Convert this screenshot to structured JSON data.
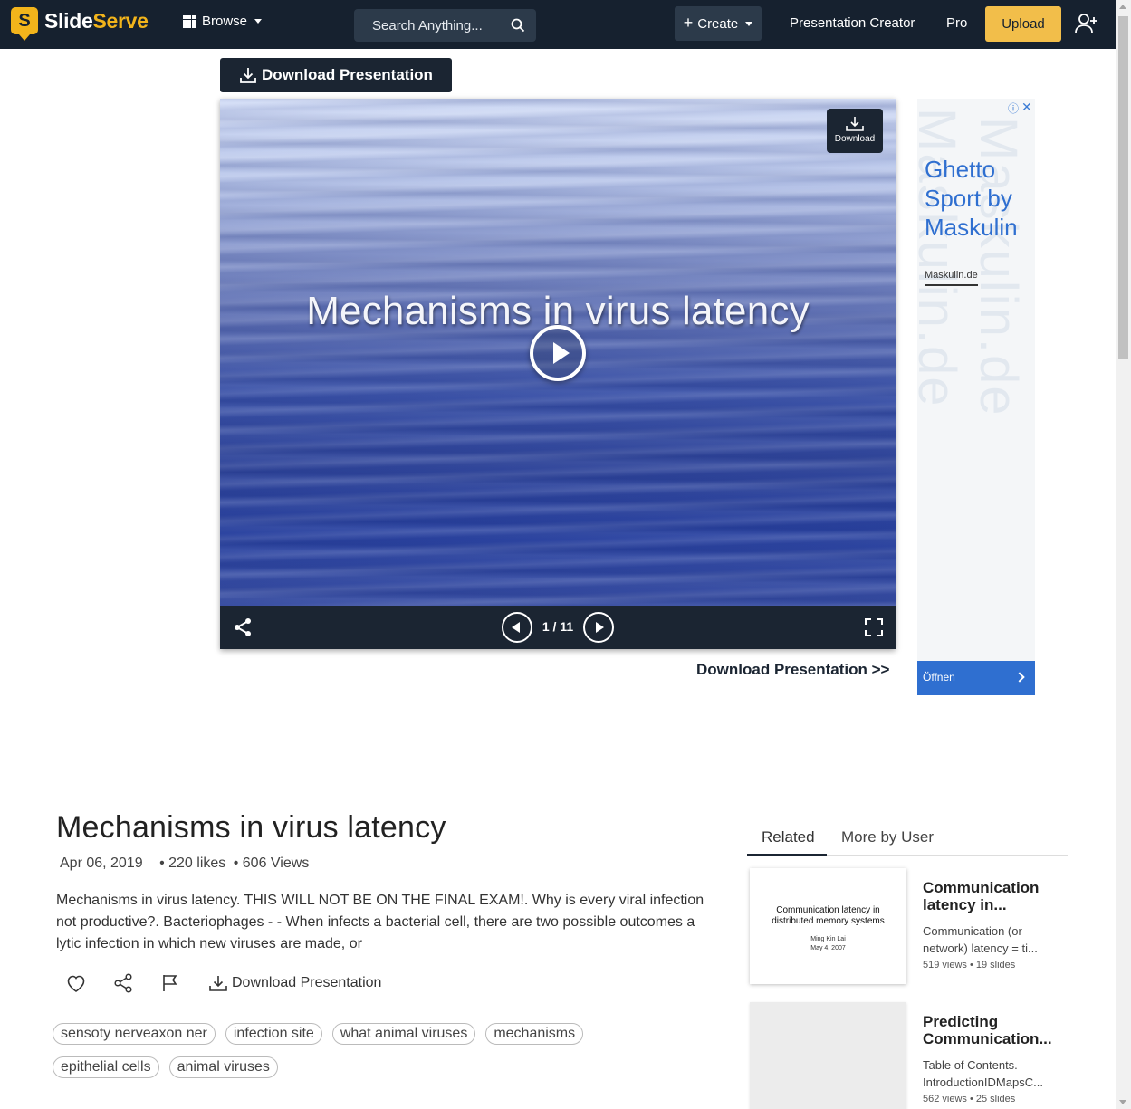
{
  "nav": {
    "brand_part1": "Slide",
    "brand_part2": "Serve",
    "brand_badge": "S",
    "browse": "Browse",
    "search_placeholder": "Search Anything...",
    "create": "Create",
    "presentation_creator": "Presentation Creator",
    "pro": "Pro",
    "upload": "Upload"
  },
  "download_top": "Download Presentation",
  "viewer": {
    "slide_title": "Mechanisms in virus latency",
    "download_label": "Download",
    "page_counter": "1 / 11"
  },
  "download_link": "Download Presentation >>",
  "ad": {
    "headline": "Ghetto Sport by Maskulin",
    "domain": "Maskulin.de",
    "open": "Öffnen",
    "info": "ⓘ",
    "close": "✕"
  },
  "presentation": {
    "title": "Mechanisms in virus latency",
    "date": "Apr 06, 2019",
    "likes": "• 220 likes",
    "views": "• 606 Views",
    "description": "Mechanisms in virus latency. THIS WILL NOT BE ON THE FINAL EXAM!. Why is every viral infection not productive?. Bacteriophages -     - When     infects a bacterial cell, there are two possible outcomes a lytic infection in which new viruses are made, or",
    "download_action": "Download Presentation",
    "tags": [
      "sensoty nerveaxon ner",
      "infection site",
      "what animal viruses",
      "mechanisms",
      "epithelial cells",
      "animal viruses"
    ]
  },
  "sidebar": {
    "tabs": [
      "Related",
      "More by User"
    ],
    "items": [
      {
        "thumb_title": "Communication latency in distributed memory systems",
        "thumb_author": "Ming Kin Lai",
        "thumb_date": "May 4, 2007",
        "title": "Communication latency in...",
        "desc": "Communication (or network) latency = ti...",
        "stats": "519 views • 19 slides"
      },
      {
        "title": "Predicting Communication...",
        "desc": "Table of Contents. IntroductionIDMapsC...",
        "stats": "562 views • 25 slides"
      }
    ]
  },
  "colors": {
    "nav_bg": "#16212f",
    "brand_accent": "#f2b41b",
    "upload_bg": "#f2be4a",
    "ad_blue": "#2f6fd0"
  }
}
